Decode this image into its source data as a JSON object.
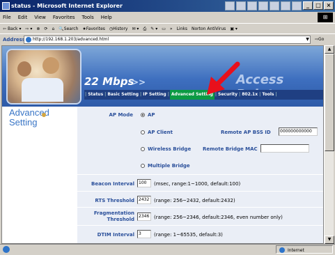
{
  "window": {
    "title": "status - Microsoft Internet Explorer",
    "menu": [
      "File",
      "Edit",
      "View",
      "Favorites",
      "Tools",
      "Help"
    ],
    "toolbar": [
      "Back",
      "Search",
      "Favorites",
      "History",
      "Links",
      "Norton AntiVirus"
    ],
    "address_label": "Address",
    "address": "http://192.168.1.203/advanced.html",
    "go_label": "Go",
    "status_zone": "Internet"
  },
  "page": {
    "speed": "22 Mbps",
    "speed_arrows": ">>",
    "brand": "Access Point",
    "nav": [
      "Status",
      "Basic Setting",
      "IP Setting",
      "Advanced Setting",
      "Security",
      "802.1x",
      "Tools"
    ],
    "section_title_1": "Advanced",
    "section_title_2": "Setting",
    "ap_mode_label": "AP Mode",
    "modes": {
      "ap": "AP",
      "ap_client": "AP Client",
      "wireless_bridge": "Wireless Bridge",
      "multiple_bridge": "Multiple Bridge"
    },
    "remote_ap_label": "Remote AP BSS ID",
    "remote_ap_value": "000000000000",
    "remote_bridge_label": "Remote Bridge MAC",
    "remote_bridge_value": "",
    "beacon_label": "Beacon Interval",
    "beacon_value": "100",
    "beacon_hint": "(msec, range:1~1000, default:100)",
    "rts_label": "RTS Threshold",
    "rts_value": "2432",
    "rts_hint": "(range: 256~2432, default:2432)",
    "frag_label_1": "Fragmentation",
    "frag_label_2": "Threshold",
    "frag_value": "2346",
    "frag_hint": "(range: 256~2346, default:2346, even number only)",
    "dtim_label": "DTIM Interval",
    "dtim_value": "3",
    "dtim_hint": "(range: 1~65535, default:3)"
  },
  "colors": {
    "nav_active": "#0b9a43",
    "label_blue": "#2a4f9a",
    "annotation_arrow": "#e8101c"
  }
}
